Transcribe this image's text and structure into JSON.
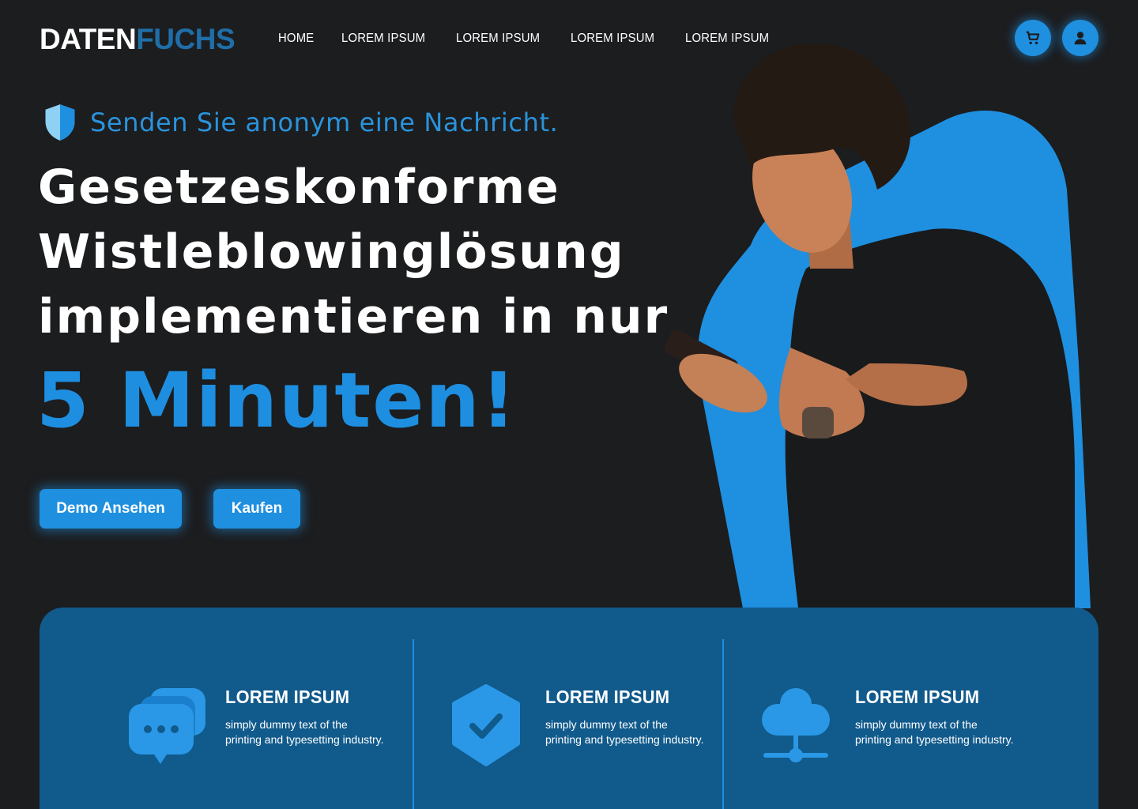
{
  "brand": {
    "part1": "DATEN",
    "part2": "FUCHS"
  },
  "nav": [
    {
      "label": "HOME"
    },
    {
      "label": "LOREM IPSUM"
    },
    {
      "label": "LOREM IPSUM"
    },
    {
      "label": "LOREM IPSUM"
    },
    {
      "label": "LOREM IPSUM"
    }
  ],
  "header_icons": [
    "cart-icon",
    "user-icon"
  ],
  "hero": {
    "tagline": "Senden Sie anonym eine Nachricht.",
    "headline_lines": [
      "Gesetzeskonforme",
      "Wistleblowinglösung",
      "implementieren in nur"
    ],
    "highlight": "5 Minuten!",
    "buttons": {
      "demo": "Demo Ansehen",
      "buy": "Kaufen"
    }
  },
  "features": [
    {
      "icon": "chat-bubbles-icon",
      "title": "LOREM IPSUM",
      "text_line1": "simply dummy text of the",
      "text_line2": "printing and typesetting industry."
    },
    {
      "icon": "shield-check-icon",
      "title": "LOREM IPSUM",
      "text_line1": "simply dummy text of the",
      "text_line2": "printing and typesetting industry."
    },
    {
      "icon": "cloud-network-icon",
      "title": "LOREM IPSUM",
      "text_line1": "simply dummy text of the",
      "text_line2": "printing and typesetting industry."
    }
  ],
  "colors": {
    "background": "#1c1d1f",
    "accent": "#1f8fe0",
    "panel": "#115a8c",
    "logo_second": "#1f6ea8"
  }
}
